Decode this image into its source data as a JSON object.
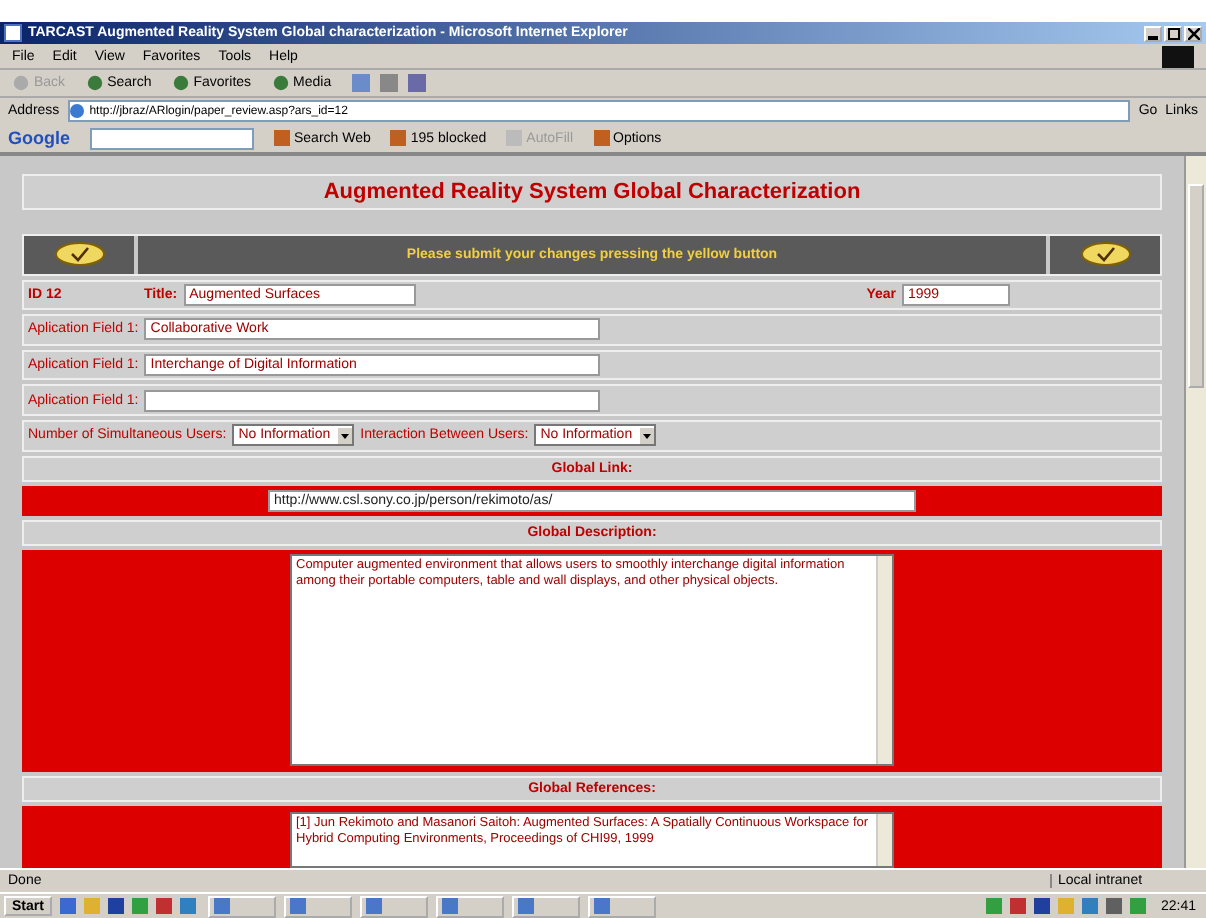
{
  "window": {
    "title": "TARCAST Augmented Reality System Global characterization - Microsoft Internet Explorer"
  },
  "menu": [
    "File",
    "Edit",
    "View",
    "Favorites",
    "Tools",
    "Help"
  ],
  "toolbar": [
    {
      "label": "Back",
      "disabled": true
    },
    {
      "label": "Search",
      "disabled": false
    },
    {
      "label": "Favorites",
      "disabled": false
    },
    {
      "label": "Media",
      "disabled": false
    }
  ],
  "address": {
    "label": "Address",
    "url": "http://jbraz/ARlogin/paper_review.asp?ars_id=12",
    "go": "Go",
    "links": "Links"
  },
  "google": {
    "logo": "Google",
    "items": [
      {
        "label": "Search Web",
        "disabled": false
      },
      {
        "label": "195 blocked",
        "disabled": false
      },
      {
        "label": "AutoFill",
        "disabled": true
      },
      {
        "label": "Options",
        "disabled": false
      }
    ]
  },
  "page": {
    "heading": "Augmented Reality System Global Characterization",
    "submit_note": "Please submit your changes pressing the yellow button",
    "id": "ID 12",
    "title_label": "Title:",
    "title_value": "Augmented Surfaces",
    "year_label": "Year",
    "year_value": "1999",
    "fields": [
      {
        "label": "Aplication Field 1:",
        "value": "Collaborative Work"
      },
      {
        "label": "Aplication Field 1:",
        "value": "Interchange of Digital Information"
      },
      {
        "label": "Aplication Field 1:"
      }
    ],
    "selects": [
      {
        "label": "Number of Simultaneous Users:",
        "value": "No Information"
      },
      {
        "label": "Interaction Between Users:",
        "value": "No Information"
      }
    ],
    "link_label": "Global Link:",
    "link_value": "http://www.csl.sony.co.jp/person/rekimoto/as/",
    "description_label": "Global Description:",
    "description": "Computer augmented environment that allows users to smoothly interchange digital information among their portable computers, table and wall displays, and other physical objects.",
    "references_label": "Global References:",
    "references": "[1] Jun Rekimoto and Masanori Saitoh: Augmented Surfaces: A Spatially Continuous Workspace for Hybrid Computing Environments, Proceedings of CHI99, 1999"
  },
  "status": {
    "text": "Done",
    "zone": "Local intranet"
  },
  "taskbar": {
    "start": "Start",
    "clock": "22:41"
  }
}
